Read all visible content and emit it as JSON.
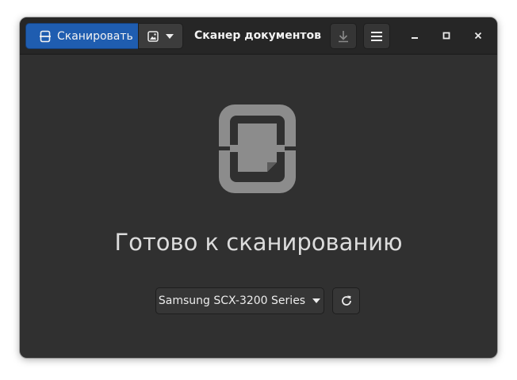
{
  "header": {
    "scan_label": "Сканировать",
    "title": "Сканер документов"
  },
  "icons": {
    "scan": "scanner-icon",
    "image_mode": "image-icon",
    "dropdown": "chevron-down-icon",
    "save": "download-icon",
    "menu": "hamburger-menu-icon",
    "minimize": "minimize-icon",
    "maximize": "maximize-icon",
    "close": "close-icon",
    "placeholder": "document-scanner-icon",
    "refresh": "refresh-icon"
  },
  "main": {
    "status_text": "Готово к сканированию",
    "device_selected": "Samsung SCX-3200 Series"
  },
  "colors": {
    "accent": "#1f5db0",
    "window_bg": "#303030",
    "header_bg": "#262626",
    "icon_gray": "#8c8c8c"
  }
}
